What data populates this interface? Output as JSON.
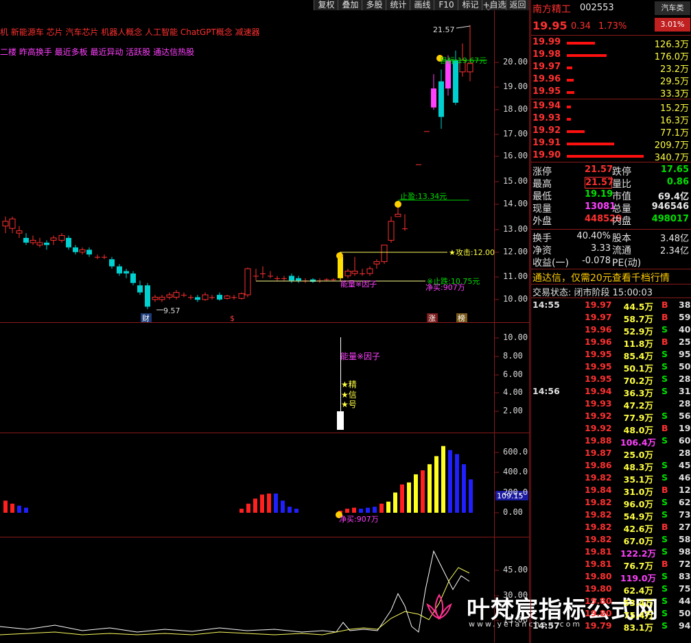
{
  "menu": [
    "复权",
    "叠加",
    "多股",
    "统计",
    "画线",
    "F10",
    "标记",
    "+自选",
    "返回"
  ],
  "concepts": {
    "line1": "机 新能源车 芯片 汽车芯片 机器人概念 人工智能 ChatGPT概念 减速器",
    "line2": "二楼 昨高换手 最近多板 最近异动 活跃股 通达信热股"
  },
  "main_axis": [
    "20.00",
    "19.00",
    "18.00",
    "17.00",
    "16.00",
    "15.00",
    "14.00",
    "13.00",
    "12.00",
    "11.00",
    "10.00"
  ],
  "annotations": {
    "high_label": "21.57",
    "low_label": "9.57",
    "target": "目标:19.67元",
    "stop_profit": "止盈:13.34元",
    "attack": "★攻击:12.00",
    "stop_loss": "※止跌:10.75元",
    "net_buy": "净买:907万",
    "energy_factor": "能量※因子",
    "marks": [
      "财",
      "$",
      "涨",
      "榜"
    ]
  },
  "panel2": {
    "axis": [
      "10.00",
      "8.00",
      "6.00",
      "4.00",
      "2.00"
    ],
    "label": "能量※因子",
    "stars": [
      "★精",
      "★信",
      "★号"
    ]
  },
  "panel3": {
    "axis": [
      "600.0",
      "400.0",
      "200.0",
      "0.00"
    ],
    "current": "109.15",
    "net_buy": "净买:907万"
  },
  "panel4": {
    "axis": [
      "45.00",
      "30.00",
      "15.00"
    ]
  },
  "watermark": {
    "title": "叶梵宸指标公式网",
    "url": "www.yefanchen.com"
  },
  "stock": {
    "name": "南方精工",
    "code": "002553",
    "sector": "汽车类",
    "price": "19.95",
    "change": "0.34",
    "pct": "1.73%",
    "ratio": "3.01%"
  },
  "sells": [
    {
      "price": "19.99",
      "vol": "126.3万",
      "bar": 0.37
    },
    {
      "price": "19.98",
      "vol": "176.0万",
      "bar": 0.52
    },
    {
      "price": "19.97",
      "vol": "23.2万",
      "bar": 0.07
    },
    {
      "price": "19.96",
      "vol": "29.5万",
      "bar": 0.09
    },
    {
      "price": "19.95",
      "vol": "33.3万",
      "bar": 0.1
    }
  ],
  "buys": [
    {
      "price": "19.94",
      "vol": "15.2万",
      "bar": 0.05
    },
    {
      "price": "19.93",
      "vol": "16.3万",
      "bar": 0.05
    },
    {
      "price": "19.92",
      "vol": "77.1万",
      "bar": 0.23
    },
    {
      "price": "19.91",
      "vol": "209.7万",
      "bar": 0.62
    },
    {
      "price": "19.90",
      "vol": "340.7万",
      "bar": 1.0
    }
  ],
  "stats": [
    {
      "l1": "涨停",
      "v1": "21.57",
      "c1": "red",
      "l2": "跌停",
      "v2": "17.65",
      "c2": "grn"
    },
    {
      "l1": "最高",
      "v1": "21.57",
      "c1": "red",
      "l2": "量比",
      "v2": "0.86",
      "c2": "grn",
      "box": true
    },
    {
      "l1": "最低",
      "v1": "19.19",
      "c1": "grn",
      "l2": "市值",
      "v2": "69.4亿",
      "c2": "wht"
    },
    {
      "l1": "现量",
      "v1": "13081",
      "c1": "mag",
      "l2": "总量",
      "v2": "946546",
      "c2": "wht"
    },
    {
      "l1": "外盘",
      "v1": "448529",
      "c1": "red",
      "l2": "内盘",
      "v2": "498017",
      "c2": "grn"
    }
  ],
  "stats2": [
    {
      "l1": "换手",
      "v1": "40.40%",
      "l2": "股本",
      "v2": "3.48亿"
    },
    {
      "l1": "净资",
      "v1": "3.33",
      "l2": "流通",
      "v2": "2.34亿"
    },
    {
      "l1": "收益(一)",
      "v1": "-0.078",
      "l2": "PE(动)",
      "v2": ""
    }
  ],
  "notice": "通达信，仅需20元查看千档行情",
  "status": "交易状态: 闭市阶段 15:00:03",
  "ticks": [
    {
      "t": "14:55",
      "p": "19.97",
      "v": "44.5万",
      "s": "B",
      "n": "38",
      "vc": "yel"
    },
    {
      "t": "",
      "p": "19.97",
      "v": "58.7万",
      "s": "B",
      "n": "59",
      "vc": "yel"
    },
    {
      "t": "",
      "p": "19.96",
      "v": "52.9万",
      "s": "S",
      "n": "40",
      "vc": "yel"
    },
    {
      "t": "",
      "p": "19.96",
      "v": "11.8万",
      "s": "B",
      "n": "25",
      "vc": "yel"
    },
    {
      "t": "",
      "p": "19.95",
      "v": "85.4万",
      "s": "S",
      "n": "95",
      "vc": "yel"
    },
    {
      "t": "",
      "p": "19.95",
      "v": "50.1万",
      "s": "S",
      "n": "50",
      "vc": "yel"
    },
    {
      "t": "",
      "p": "19.95",
      "v": "70.2万",
      "s": "S",
      "n": "28",
      "vc": "yel"
    },
    {
      "t": "14:56",
      "p": "19.94",
      "v": "36.3万",
      "s": "S",
      "n": "31",
      "vc": "yel"
    },
    {
      "t": "",
      "p": "19.93",
      "v": "47.2万",
      "s": "",
      "n": "28",
      "vc": "yel"
    },
    {
      "t": "",
      "p": "19.92",
      "v": "77.9万",
      "s": "S",
      "n": "56",
      "vc": "yel"
    },
    {
      "t": "",
      "p": "19.92",
      "v": "48.0万",
      "s": "B",
      "n": "19",
      "vc": "yel"
    },
    {
      "t": "",
      "p": "19.88",
      "v": "106.4万",
      "s": "S",
      "n": "60",
      "vc": "mag"
    },
    {
      "t": "",
      "p": "19.87",
      "v": "25.0万",
      "s": "",
      "n": "28",
      "vc": "yel"
    },
    {
      "t": "",
      "p": "19.86",
      "v": "48.3万",
      "s": "S",
      "n": "45",
      "vc": "yel"
    },
    {
      "t": "",
      "p": "19.82",
      "v": "35.1万",
      "s": "S",
      "n": "46",
      "vc": "yel"
    },
    {
      "t": "",
      "p": "19.84",
      "v": "31.0万",
      "s": "B",
      "n": "12",
      "vc": "yel"
    },
    {
      "t": "",
      "p": "19.82",
      "v": "96.0万",
      "s": "S",
      "n": "62",
      "vc": "yel"
    },
    {
      "t": "",
      "p": "19.82",
      "v": "54.9万",
      "s": "S",
      "n": "73",
      "vc": "yel"
    },
    {
      "t": "",
      "p": "19.82",
      "v": "42.6万",
      "s": "B",
      "n": "27",
      "vc": "yel"
    },
    {
      "t": "",
      "p": "19.82",
      "v": "67.0万",
      "s": "S",
      "n": "58",
      "vc": "yel"
    },
    {
      "t": "",
      "p": "19.81",
      "v": "122.2万",
      "s": "S",
      "n": "98",
      "vc": "mag"
    },
    {
      "t": "",
      "p": "19.81",
      "v": "76.7万",
      "s": "B",
      "n": "72",
      "vc": "yel"
    },
    {
      "t": "",
      "p": "19.80",
      "v": "119.0万",
      "s": "S",
      "n": "83",
      "vc": "mag"
    },
    {
      "t": "",
      "p": "19.80",
      "v": "62.4万",
      "s": "S",
      "n": "75",
      "vc": "yel"
    },
    {
      "t": "",
      "p": "19.80",
      "v": "53.4万",
      "s": "S",
      "n": "44",
      "vc": "yel"
    },
    {
      "t": "",
      "p": "19.80",
      "v": "75.4万",
      "s": "S",
      "n": "50",
      "vc": "yel"
    },
    {
      "t": "14:57",
      "p": "19.79",
      "v": "83.1万",
      "s": "S",
      "n": "94",
      "vc": "yel"
    }
  ]
}
